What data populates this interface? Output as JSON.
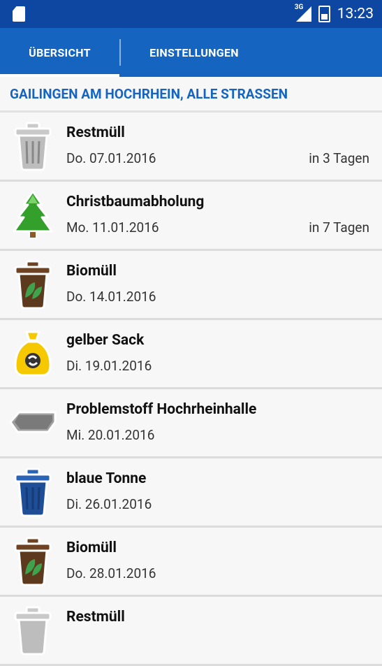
{
  "status": {
    "network": "3G",
    "time": "13:23"
  },
  "tabs": [
    {
      "label": "ÜBERSICHT",
      "active": true
    },
    {
      "label": "EINSTELLUNGEN",
      "active": false
    }
  ],
  "location": "GAILINGEN AM HOCHRHEIN, ALLE STRASSEN",
  "items": [
    {
      "title": "Restmüll",
      "date": "Do. 07.01.2016",
      "relative": "in 3 Tagen",
      "icon": "gray-bin-icon"
    },
    {
      "title": "Christbaumabholung",
      "date": "Mo. 11.01.2016",
      "relative": "in 7 Tagen",
      "icon": "christmas-tree-icon"
    },
    {
      "title": "Biomüll",
      "date": "Do. 14.01.2016",
      "relative": "",
      "icon": "brown-bin-icon"
    },
    {
      "title": "gelber Sack",
      "date": "Di. 19.01.2016",
      "relative": "",
      "icon": "yellow-sack-icon"
    },
    {
      "title": "Problemstoff Hochrheinhalle",
      "date": "Mi. 20.01.2016",
      "relative": "",
      "icon": "container-icon"
    },
    {
      "title": "blaue Tonne",
      "date": "Di. 26.01.2016",
      "relative": "",
      "icon": "blue-bin-icon"
    },
    {
      "title": "Biomüll",
      "date": "Do. 28.01.2016",
      "relative": "",
      "icon": "brown-bin-icon"
    },
    {
      "title": "Restmüll",
      "date": "",
      "relative": "",
      "icon": "gray-bin-icon"
    }
  ]
}
